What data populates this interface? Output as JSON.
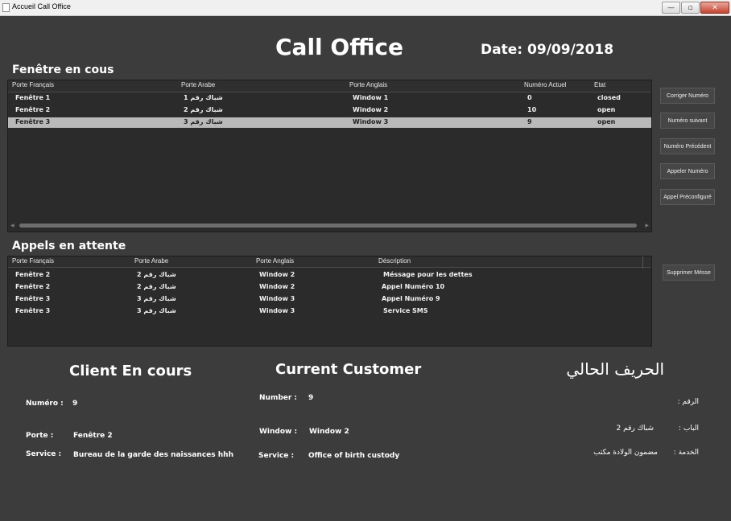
{
  "window": {
    "title": "Accueil Call Office",
    "minimize": "—",
    "maximize": "▫",
    "close": "✕"
  },
  "header": {
    "title": "Call Office",
    "date_label": "Date:",
    "date_value": "09/09/2018"
  },
  "windows_section": {
    "title": "Fenêtre en cous",
    "columns": [
      "Porte Français",
      "Porte Arabe",
      "Porte Anglais",
      "Numéro Actuel",
      "Etat"
    ],
    "rows": [
      [
        "Fenêtre 1",
        "شباك رقم 1",
        "Window 1",
        "0",
        "closed"
      ],
      [
        "Fenêtre 2",
        "شباك رقم 2",
        "Window 2",
        "10",
        "open"
      ],
      [
        "Fenêtre 3",
        "شباك رقم 3",
        "Window 3",
        "9",
        "open"
      ]
    ],
    "selected_row": 2
  },
  "side_buttons": {
    "corriger": "Corriger Numéro",
    "suivant": "Numéro suivant",
    "precedent": "Numéro Précédent",
    "appeler": "Appeler Numéro",
    "preconfigure": "Appel Préconfiguré",
    "supprimer": "Supprimer Mésse"
  },
  "waiting_section": {
    "title": "Appels en attente",
    "columns": [
      "Porte Français",
      "Porte Arabe",
      "Porte Anglais",
      "Déscription"
    ],
    "rows": [
      [
        "Fenêtre 2",
        "شباك رقم 2",
        "Window 2",
        "Méssage pour les dettes"
      ],
      [
        "Fenêtre 2",
        "شباك رقم 2",
        "Window 2",
        "Appel Numéro 10"
      ],
      [
        "Fenêtre 3",
        "شباك رقم 3",
        "Window 3",
        "Appel Numéro 9"
      ],
      [
        "Fenêtre 3",
        "شباك رقم 3",
        "Window 3",
        "Service SMS"
      ]
    ]
  },
  "client_fr": {
    "heading": "Client En cours",
    "number_label": "Numéro :",
    "number_value": "9",
    "window_label": "Porte :",
    "window_value": "Fenêtre 2",
    "service_label": "Service :",
    "service_value": "Bureau de la garde des naissances hhh"
  },
  "client_en": {
    "heading": "Current Customer",
    "number_label": "Number :",
    "number_value": "9",
    "window_label": "Window :",
    "window_value": "Window 2",
    "service_label": "Service :",
    "service_value": "Office of birth custody"
  },
  "client_ar": {
    "heading": "الحريف الحالي",
    "number_label": "الرقم :",
    "window_label": "الباب :",
    "window_value": "شباك رقم 2",
    "service_label": "الخدمة :",
    "service_value": "مضمون الولادة مكتب"
  }
}
